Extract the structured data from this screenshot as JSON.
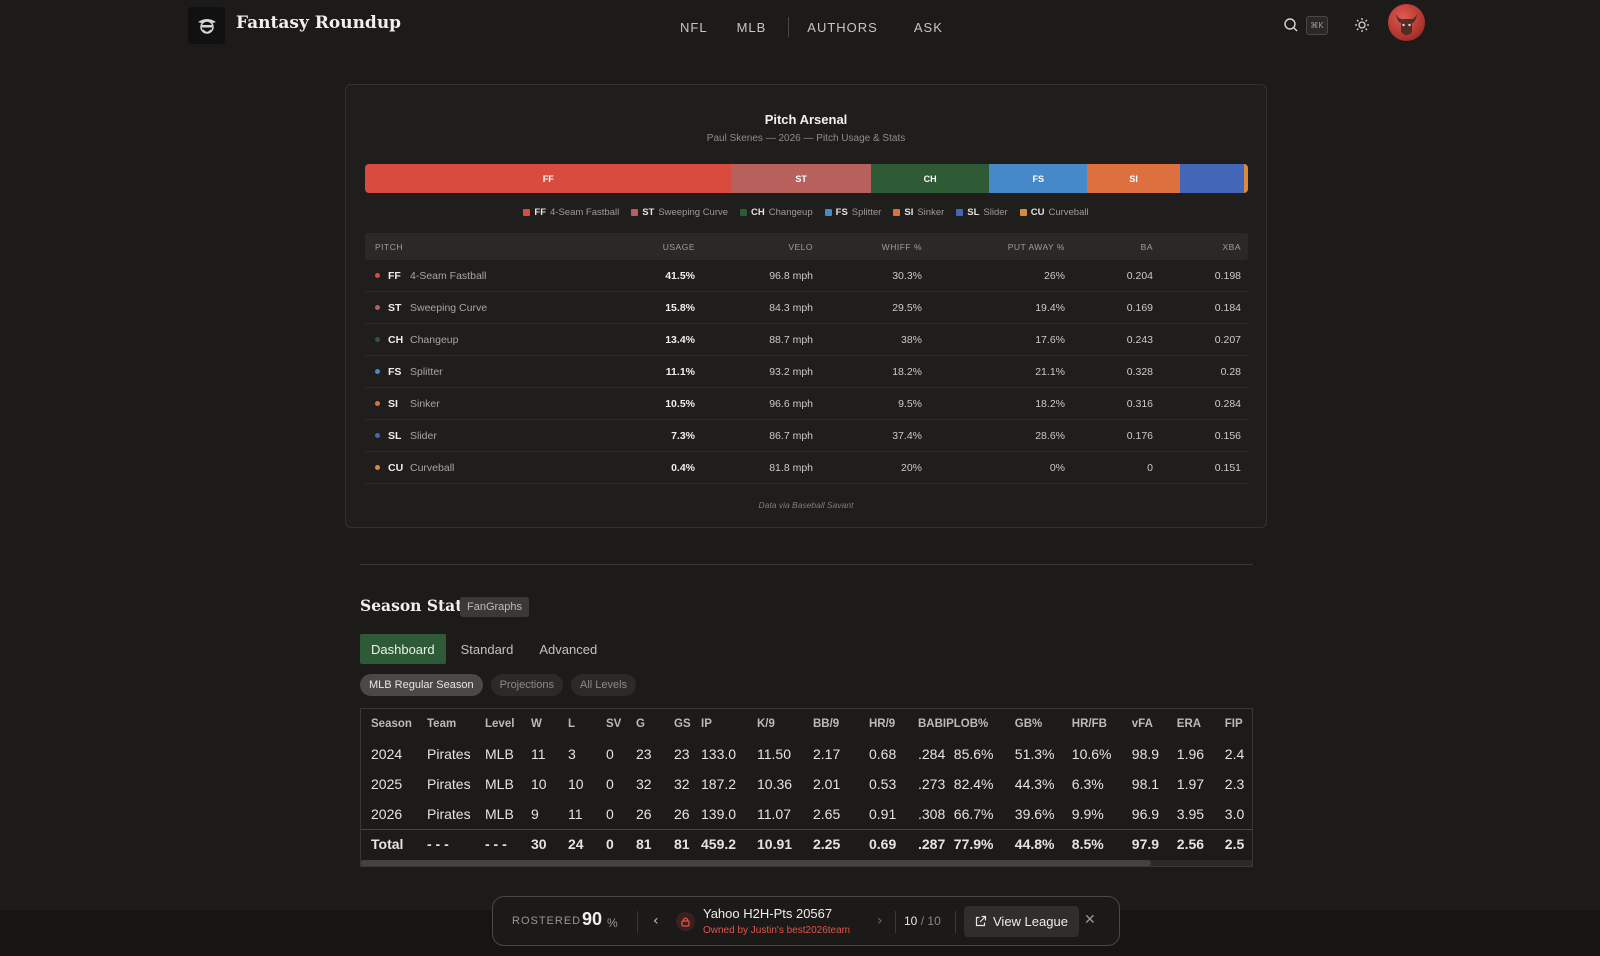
{
  "header": {
    "brand": "Fantasy Roundup",
    "nav": [
      "NFL",
      "MLB",
      "AUTHORS",
      "ASK"
    ],
    "search_shortcut": "⌘K",
    "icons": {
      "logo": "cowboy-mascot-icon",
      "search": "search-icon",
      "theme": "sun-icon",
      "avatar": "bull-avatar"
    }
  },
  "arsenal": {
    "title": "Pitch Arsenal",
    "subtitle": "Paul Skenes — 2026 — Pitch Usage & Stats",
    "bar_segments": [
      {
        "code": "FF",
        "usage": 41.5,
        "color": "#d94a3f",
        "label": "FF"
      },
      {
        "code": "ST",
        "usage": 15.8,
        "color": "#b8605b",
        "label": "ST"
      },
      {
        "code": "CH",
        "usage": 13.4,
        "color": "#2e5a35",
        "label": "CH"
      },
      {
        "code": "FS",
        "usage": 11.1,
        "color": "#4689c9",
        "label": "FS"
      },
      {
        "code": "SI",
        "usage": 10.5,
        "color": "#de7040",
        "label": "SI"
      },
      {
        "code": "SL",
        "usage": 7.3,
        "color": "#4366b8",
        "label": ""
      },
      {
        "code": "CU",
        "usage": 0.4,
        "color": "#d98a3f",
        "label": ""
      }
    ],
    "legend": [
      {
        "code": "FF",
        "name": "4-Seam Fastball",
        "color": "#d94a3f"
      },
      {
        "code": "ST",
        "name": "Sweeping Curve",
        "color": "#b8605b"
      },
      {
        "code": "CH",
        "name": "Changeup",
        "color": "#2e5a35"
      },
      {
        "code": "FS",
        "name": "Splitter",
        "color": "#4689c9"
      },
      {
        "code": "SI",
        "name": "Sinker",
        "color": "#de7040"
      },
      {
        "code": "SL",
        "name": "Slider",
        "color": "#4366b8"
      },
      {
        "code": "CU",
        "name": "Curveball",
        "color": "#d98a3f"
      }
    ],
    "columns": [
      "PITCH",
      "USAGE",
      "VELO",
      "WHIFF %",
      "PUT AWAY %",
      "BA",
      "XBA"
    ],
    "rows": [
      {
        "code": "FF",
        "name": "4-Seam Fastball",
        "color": "#d94a3f",
        "usage": "41.5%",
        "velo": "96.8 mph",
        "whiff": "30.3%",
        "putaway": "26%",
        "ba": "0.204",
        "xba": "0.198"
      },
      {
        "code": "ST",
        "name": "Sweeping Curve",
        "color": "#b8605b",
        "usage": "15.8%",
        "velo": "84.3 mph",
        "whiff": "29.5%",
        "putaway": "19.4%",
        "ba": "0.169",
        "xba": "0.184"
      },
      {
        "code": "CH",
        "name": "Changeup",
        "color": "#2e5a35",
        "usage": "13.4%",
        "velo": "88.7 mph",
        "whiff": "38%",
        "putaway": "17.6%",
        "ba": "0.243",
        "xba": "0.207"
      },
      {
        "code": "FS",
        "name": "Splitter",
        "color": "#4689c9",
        "usage": "11.1%",
        "velo": "93.2 mph",
        "whiff": "18.2%",
        "putaway": "21.1%",
        "ba": "0.328",
        "xba": "0.28"
      },
      {
        "code": "SI",
        "name": "Sinker",
        "color": "#de7040",
        "usage": "10.5%",
        "velo": "96.6 mph",
        "whiff": "9.5%",
        "putaway": "18.2%",
        "ba": "0.316",
        "xba": "0.284"
      },
      {
        "code": "SL",
        "name": "Slider",
        "color": "#4366b8",
        "usage": "7.3%",
        "velo": "86.7 mph",
        "whiff": "37.4%",
        "putaway": "28.6%",
        "ba": "0.176",
        "xba": "0.156"
      },
      {
        "code": "CU",
        "name": "Curveball",
        "color": "#d98a3f",
        "usage": "0.4%",
        "velo": "81.8 mph",
        "whiff": "20%",
        "putaway": "0%",
        "ba": "0",
        "xba": "0.151"
      }
    ],
    "credit": "Data via Baseball Savant"
  },
  "season_stats": {
    "title": "Season Stats",
    "badge": "FanGraphs",
    "tabs": [
      "Dashboard",
      "Standard",
      "Advanced"
    ],
    "active_tab": "Dashboard",
    "filters": [
      "MLB Regular Season",
      "Projections",
      "All Levels"
    ],
    "active_filter": "MLB Regular Season",
    "columns": [
      "Season",
      "Team",
      "Level",
      "W",
      "L",
      "SV",
      "G",
      "GS",
      "IP",
      "K/9",
      "BB/9",
      "HR/9",
      "BABIP",
      "LOB%",
      "GB%",
      "HR/FB",
      "vFA",
      "ERA",
      "FIP"
    ],
    "rows": [
      [
        "2024",
        "Pirates",
        "MLB",
        "11",
        "3",
        "0",
        "23",
        "23",
        "133.0",
        "11.50",
        "2.17",
        "0.68",
        ".284",
        "85.6%",
        "51.3%",
        "10.6%",
        "98.9",
        "1.96",
        "2.4"
      ],
      [
        "2025",
        "Pirates",
        "MLB",
        "10",
        "10",
        "0",
        "32",
        "32",
        "187.2",
        "10.36",
        "2.01",
        "0.53",
        ".273",
        "82.4%",
        "44.3%",
        "6.3%",
        "98.1",
        "1.97",
        "2.3"
      ],
      [
        "2026",
        "Pirates",
        "MLB",
        "9",
        "11",
        "0",
        "26",
        "26",
        "139.0",
        "11.07",
        "2.65",
        "0.91",
        ".308",
        "66.7%",
        "39.6%",
        "9.9%",
        "96.9",
        "3.95",
        "3.0"
      ]
    ],
    "total": [
      "Total",
      "- - -",
      "- - -",
      "30",
      "24",
      "0",
      "81",
      "81",
      "459.2",
      "10.91",
      "2.25",
      "0.69",
      ".287",
      "77.9%",
      "44.8%",
      "8.5%",
      "97.9",
      "2.56",
      "2.5"
    ]
  },
  "dock": {
    "rostered_label": "ROSTERED",
    "rostered_value": "90",
    "rostered_unit": "%",
    "league_name": "Yahoo H2H-Pts 20567",
    "league_owner": "Owned by Justin's best2026team",
    "page_current": "10",
    "page_sep": "/",
    "page_total": "10",
    "view_label": "View League"
  }
}
